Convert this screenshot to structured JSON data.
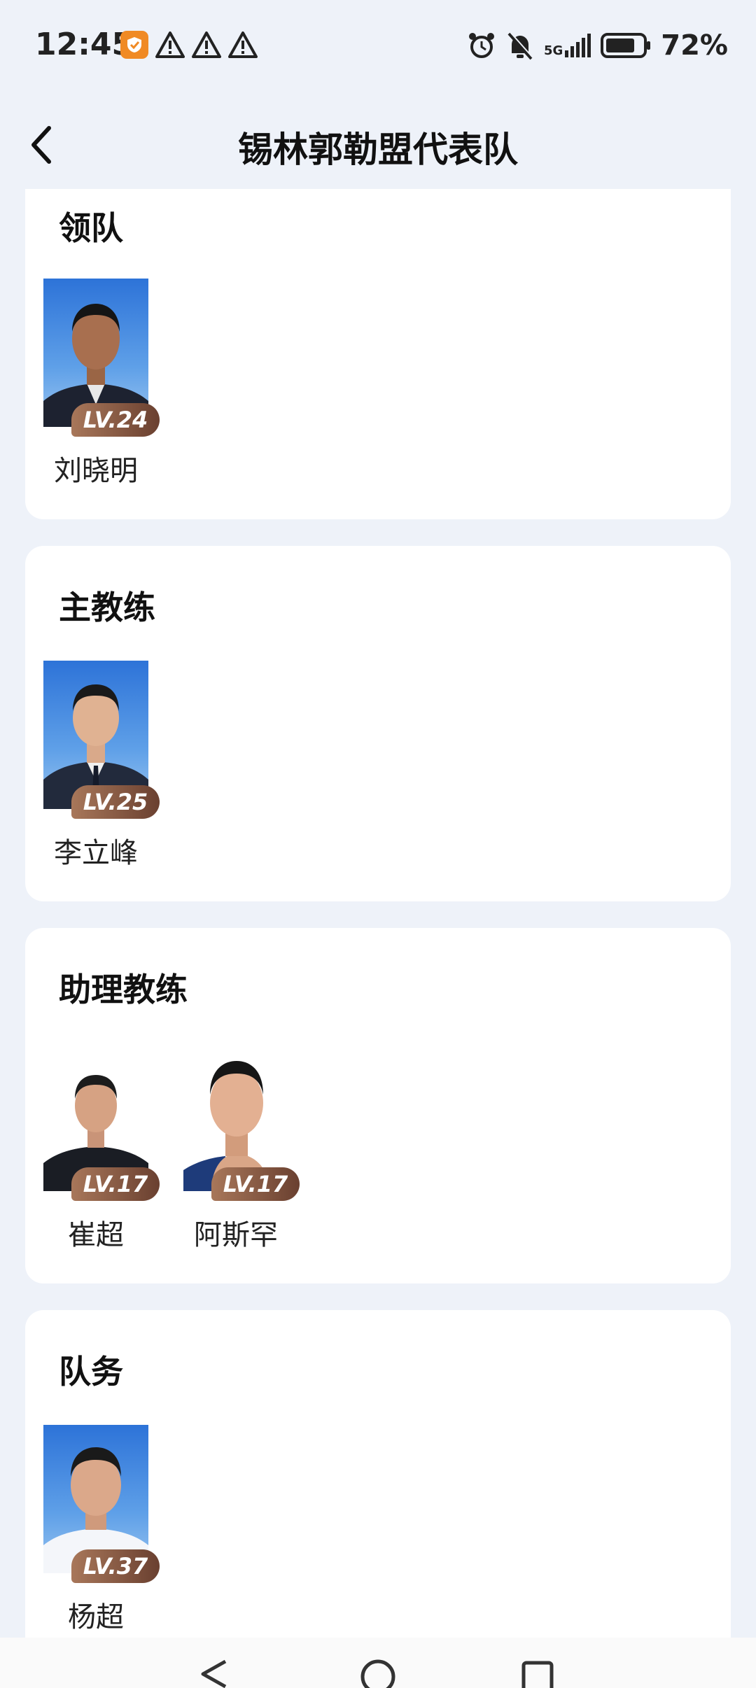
{
  "status": {
    "time": "12:45",
    "battery": "72%",
    "network": "5G"
  },
  "header": {
    "title": "锡林郭勒盟代表队"
  },
  "sections": [
    {
      "title": "领队",
      "members": [
        {
          "name": "刘晓明",
          "level": "LV.24",
          "photo_bg": "blue"
        }
      ]
    },
    {
      "title": "主教练",
      "members": [
        {
          "name": "李立峰",
          "level": "LV.25",
          "photo_bg": "blue"
        }
      ]
    },
    {
      "title": "助理教练",
      "members": [
        {
          "name": "崔超",
          "level": "LV.17",
          "photo_bg": "white"
        },
        {
          "name": "阿斯罕",
          "level": "LV.17",
          "photo_bg": "white"
        }
      ]
    },
    {
      "title": "队务",
      "members": [
        {
          "name": "杨超",
          "level": "LV.37",
          "photo_bg": "blue"
        }
      ]
    }
  ],
  "colors": {
    "background": "#eef2f9",
    "card": "#ffffff",
    "badge_start": "#a8775a",
    "badge_end": "#6a4030"
  }
}
